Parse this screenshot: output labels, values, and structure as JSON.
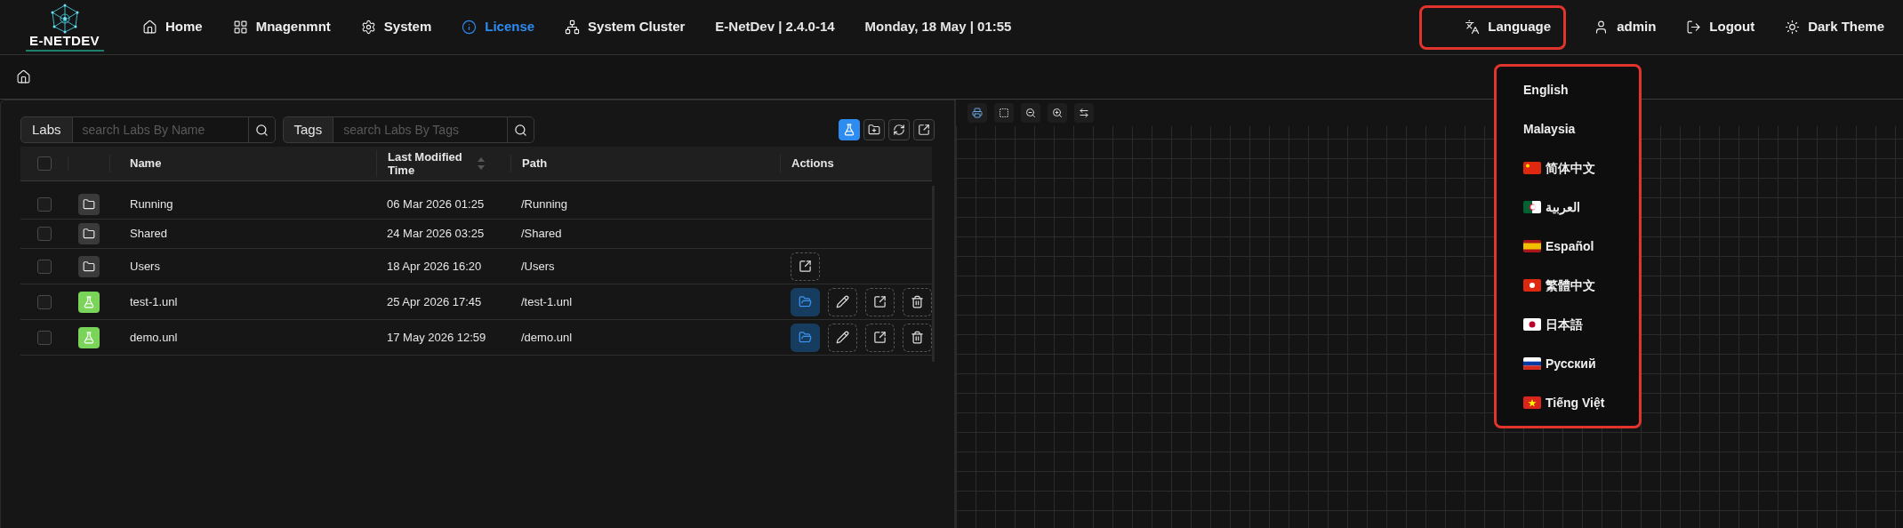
{
  "logo": {
    "text": "E-NETDEV"
  },
  "nav": [
    {
      "label": "Home",
      "selected": false
    },
    {
      "label": "Mnagenmnt",
      "selected": false
    },
    {
      "label": "System",
      "selected": false
    },
    {
      "label": "License",
      "selected": true
    },
    {
      "label": "System Cluster",
      "selected": false
    }
  ],
  "version": "E-NetDev | 2.4.0-14",
  "datetime": "Monday, 18 May | 01:55",
  "right_menu": [
    {
      "label": "Language",
      "highlighted": true
    },
    {
      "label": "admin",
      "highlighted": false
    },
    {
      "label": "Logout",
      "highlighted": false
    },
    {
      "label": "Dark Theme",
      "highlighted": false
    }
  ],
  "language_menu": {
    "highlighted": true,
    "items": [
      {
        "label": "English"
      },
      {
        "label": "Malaysia"
      },
      {
        "kind": "china",
        "label": "简体中文"
      },
      {
        "kind": "algeria",
        "label": "العربية"
      },
      {
        "kind": "spain",
        "label": "Español"
      },
      {
        "kind": "hongkong",
        "label": "繁體中文"
      },
      {
        "kind": "japan",
        "label": "日本語"
      },
      {
        "kind": "russia",
        "label": "Русский"
      },
      {
        "kind": "vietnam",
        "label": "Tiếng Việt"
      }
    ]
  },
  "search": [
    {
      "label": "Labs",
      "placeholder": "search Labs By Name"
    },
    {
      "label": "Tags",
      "placeholder": "search Labs By Tags"
    }
  ],
  "toolbar": [
    {
      "selected": true
    },
    {
      "selected": false
    },
    {
      "selected": false
    },
    {
      "selected": false
    }
  ],
  "table": {
    "all_checked": false,
    "columns": [
      "Name",
      "Last Modified Time",
      "Path",
      "Actions"
    ],
    "rows": [
      {
        "kind": "folder",
        "checked": false,
        "name": "Running",
        "modified": "06 Mar 2026 01:25",
        "path": "/Running",
        "actions": []
      },
      {
        "kind": "folder",
        "checked": false,
        "name": "Shared",
        "modified": "24 Mar 2026 03:25",
        "path": "/Shared",
        "actions": []
      },
      {
        "kind": "folder",
        "checked": false,
        "name": "Users",
        "modified": "18 Apr 2026 16:20",
        "path": "/Users",
        "actions": [
          {
            "kind": "export"
          }
        ]
      },
      {
        "kind": "lab",
        "checked": false,
        "name": "test-1.unl",
        "modified": "25 Apr 2026 17:45",
        "path": "/test-1.unl",
        "actions": [
          {
            "kind": "open"
          },
          {
            "kind": "edit"
          },
          {
            "kind": "export"
          },
          {
            "kind": "delete"
          }
        ]
      },
      {
        "kind": "lab",
        "checked": false,
        "name": "demo.unl",
        "modified": "17 May 2026 12:59",
        "path": "/demo.unl",
        "actions": [
          {
            "kind": "open"
          },
          {
            "kind": "edit"
          },
          {
            "kind": "export"
          },
          {
            "kind": "delete"
          }
        ]
      }
    ]
  }
}
